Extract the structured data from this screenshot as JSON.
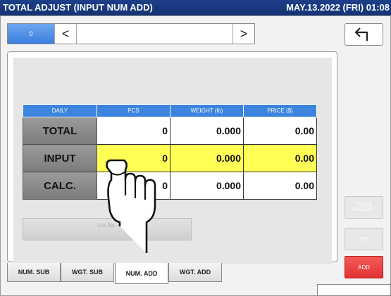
{
  "title_bar": {
    "title": "TOTAL ADJUST (INPUT NUM ADD)",
    "datetime": "MAY.13.2022 (FRI) 01:08"
  },
  "nav": {
    "counter": "0",
    "prev_icon": "chevron-left-icon",
    "next_icon": "chevron-right-icon",
    "prev_glyph": "<",
    "next_glyph": ">",
    "back_icon": "return-arrow-icon"
  },
  "table": {
    "headers": [
      "DAILY",
      "PCS",
      "WEIGHT (lb)",
      "PRICE ($)"
    ],
    "rows": [
      {
        "label": "TOTAL",
        "pcs": "0",
        "weight": "0.000",
        "price": "0.00"
      },
      {
        "label": "INPUT",
        "pcs": "0",
        "weight": "0.000",
        "price": "0.00"
      },
      {
        "label": "CALC.",
        "pcs": "0",
        "weight": "0.000",
        "price": "0.00"
      }
    ]
  },
  "lot_button": {
    "label": "Lot No."
  },
  "tabs": [
    "NUM. SUB",
    "WGT. SUB",
    "NUM. ADD",
    "WGT. ADD"
  ],
  "active_tab": "NUM. ADD",
  "side_buttons": {
    "trace": "TRACE HISTORY",
    "sub": "SUB",
    "add": "ADD"
  },
  "colors": {
    "title_bg": "#153374",
    "header_blue": "#3c84dd",
    "highlight": "#ffff55",
    "add_red": "#e23030"
  }
}
